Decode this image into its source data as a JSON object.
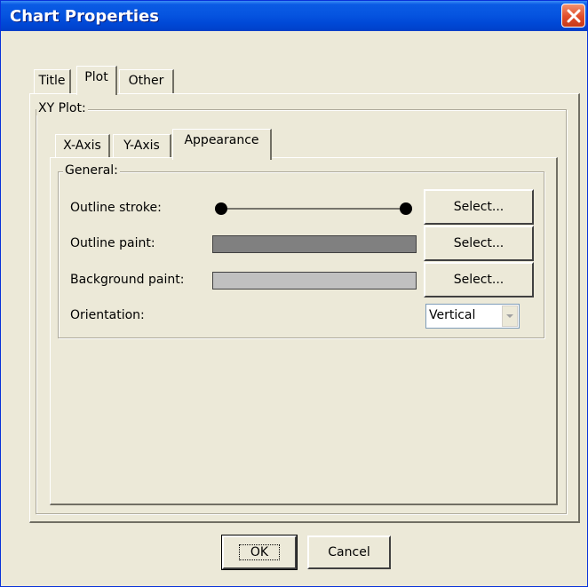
{
  "window": {
    "title": "Chart Properties",
    "close_icon": "close-icon"
  },
  "tabs": [
    {
      "label": "Title",
      "selected": false
    },
    {
      "label": "Plot",
      "selected": true
    },
    {
      "label": "Other",
      "selected": false
    }
  ],
  "plot": {
    "group_label": "XY Plot:",
    "subtabs": [
      {
        "label": "X-Axis",
        "selected": false
      },
      {
        "label": "Y-Axis",
        "selected": false
      },
      {
        "label": "Appearance",
        "selected": true
      }
    ],
    "general": {
      "group_label": "General:",
      "outline_stroke": {
        "label": "Outline stroke:",
        "button": "Select..."
      },
      "outline_paint": {
        "label": "Outline paint:",
        "button": "Select...",
        "color": "#808080"
      },
      "background_paint": {
        "label": "Background paint:",
        "button": "Select...",
        "color": "#c0c0c0"
      },
      "orientation": {
        "label": "Orientation:",
        "value": "Vertical"
      }
    }
  },
  "footer": {
    "ok_label": "OK",
    "cancel_label": "Cancel"
  },
  "colors": {
    "title_bar": "#0655e0",
    "close_button": "#e14d2a",
    "dialog_bg": "#ece9d8"
  }
}
